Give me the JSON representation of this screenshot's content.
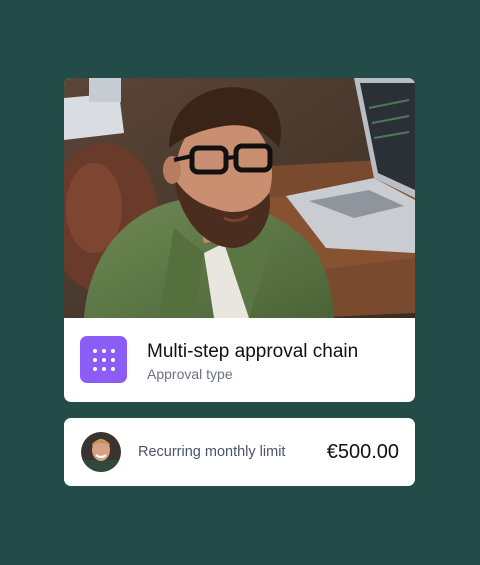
{
  "approval": {
    "title": "Multi-step approval chain",
    "subtitle": "Approval type",
    "icon": "grid-dots-icon",
    "icon_color": "#8b5cf6"
  },
  "limit": {
    "label": "Recurring monthly limit",
    "amount": "€500.00"
  },
  "colors": {
    "background": "#234b47",
    "card": "#ffffff"
  }
}
